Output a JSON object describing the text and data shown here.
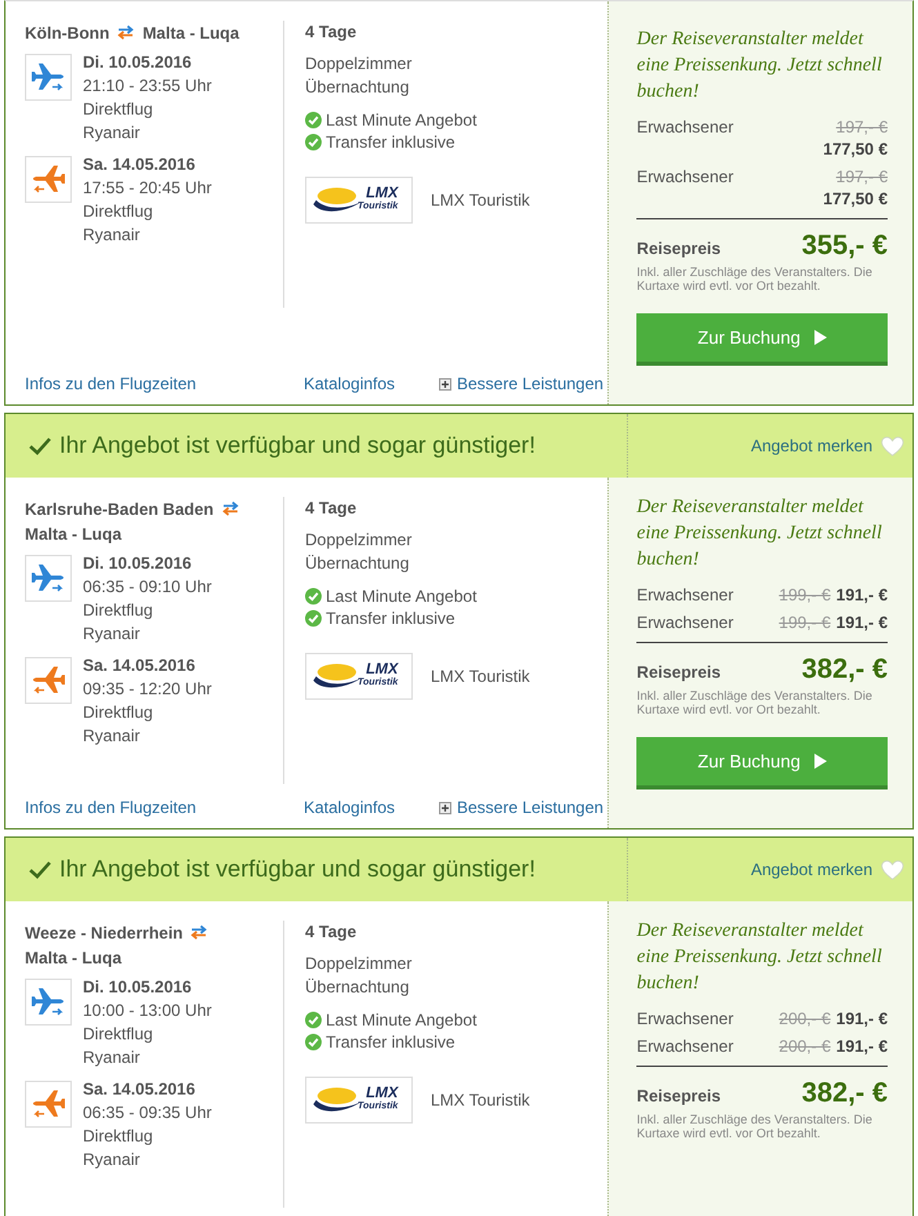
{
  "offers": [
    {
      "route": {
        "from": "Köln-Bonn",
        "to": "Malta - Luqa"
      },
      "flights": [
        {
          "kind": "outbound",
          "date": "Di. 10.05.2016",
          "time": "21:10 - 23:55 Uhr",
          "type": "Direktflug",
          "airline": "Ryanair"
        },
        {
          "kind": "return",
          "date": "Sa. 14.05.2016",
          "time": "17:55 - 20:45 Uhr",
          "type": "Direktflug",
          "airline": "Ryanair"
        }
      ],
      "duration": "4 Tage",
      "room": "Doppelzimmer",
      "board": "Übernachtung",
      "features": [
        "Last Minute Angebot",
        "Transfer inklusive"
      ],
      "operator": {
        "name": "LMX Touristik",
        "logo_text": [
          "LMX",
          "Touristik"
        ]
      },
      "price_notice": "Der Reiseveranstalter meldet eine Preissenkung. Jetzt schnell buchen!",
      "passengers": [
        {
          "kind": "stacked",
          "label": "Erwachsener",
          "old_price": "197,- €",
          "price": "177,50 €"
        },
        {
          "kind": "stacked",
          "label": "Erwachsener",
          "old_price": "197,- €",
          "price": "177,50 €"
        }
      ],
      "total_label": "Reisepreis",
      "total": "355,- €",
      "total_note": "Inkl. aller Zuschläge des Veranstalters. Die Kurtaxe wird evtl. vor Ort bezahlt.",
      "button": "Zur Buchung",
      "links": [
        {
          "kind": "link",
          "label": "Infos zu den Flugzeiten"
        },
        {
          "kind": "link",
          "label": "Kataloginfos"
        },
        {
          "kind": "expand",
          "label": "Bessere Leistungen"
        }
      ]
    },
    {
      "banner": {
        "text": "Ihr Angebot ist verfügbar und sogar günstiger!",
        "bookmark": "Angebot merken"
      },
      "route": {
        "from": "Karlsruhe-Baden Baden",
        "to": "Malta - Luqa"
      },
      "flights": [
        {
          "kind": "outbound",
          "date": "Di. 10.05.2016",
          "time": "06:35 - 09:10 Uhr",
          "type": "Direktflug",
          "airline": "Ryanair"
        },
        {
          "kind": "return",
          "date": "Sa. 14.05.2016",
          "time": "09:35 - 12:20 Uhr",
          "type": "Direktflug",
          "airline": "Ryanair"
        }
      ],
      "duration": "4 Tage",
      "room": "Doppelzimmer",
      "board": "Übernachtung",
      "features": [
        "Last Minute Angebot",
        "Transfer inklusive"
      ],
      "operator": {
        "name": "LMX Touristik",
        "logo_text": [
          "LMX",
          "Touristik"
        ]
      },
      "price_notice": "Der Reiseveranstalter meldet eine Preissenkung. Jetzt schnell buchen!",
      "passengers": [
        {
          "kind": "inline",
          "label": "Erwachsener",
          "old_price": "199,- €",
          "price": "191,- €"
        },
        {
          "kind": "inline",
          "label": "Erwachsener",
          "old_price": "199,- €",
          "price": "191,- €"
        }
      ],
      "total_label": "Reisepreis",
      "total": "382,- €",
      "total_note": "Inkl. aller Zuschläge des Veranstalters. Die Kurtaxe wird evtl. vor Ort bezahlt.",
      "button": "Zur Buchung",
      "links": [
        {
          "kind": "link",
          "label": "Infos zu den Flugzeiten"
        },
        {
          "kind": "link",
          "label": "Kataloginfos"
        },
        {
          "kind": "expand",
          "label": "Bessere Leistungen"
        }
      ]
    },
    {
      "banner": {
        "text": "Ihr Angebot ist verfügbar und sogar günstiger!",
        "bookmark": "Angebot merken"
      },
      "route": {
        "from": "Weeze - Niederrhein",
        "to": "Malta - Luqa"
      },
      "flights": [
        {
          "kind": "outbound",
          "date": "Di. 10.05.2016",
          "time": "10:00 - 13:00 Uhr",
          "type": "Direktflug",
          "airline": "Ryanair"
        },
        {
          "kind": "return",
          "date": "Sa. 14.05.2016",
          "time": "06:35 - 09:35 Uhr",
          "type": "Direktflug",
          "airline": "Ryanair"
        }
      ],
      "duration": "4 Tage",
      "room": "Doppelzimmer",
      "board": "Übernachtung",
      "features": [
        "Last Minute Angebot",
        "Transfer inklusive"
      ],
      "operator": {
        "name": "LMX Touristik",
        "logo_text": [
          "LMX",
          "Touristik"
        ]
      },
      "price_notice": "Der Reiseveranstalter meldet eine Preissenkung. Jetzt schnell buchen!",
      "passengers": [
        {
          "kind": "inline",
          "label": "Erwachsener",
          "old_price": "200,- €",
          "price": "191,- €"
        },
        {
          "kind": "inline",
          "label": "Erwachsener",
          "old_price": "200,- €",
          "price": "191,- €"
        }
      ],
      "total_label": "Reisepreis",
      "total": "382,- €",
      "total_note": "Inkl. aller Zuschläge des Veranstalters. Die Kurtaxe wird evtl. vor Ort bezahlt."
    }
  ]
}
